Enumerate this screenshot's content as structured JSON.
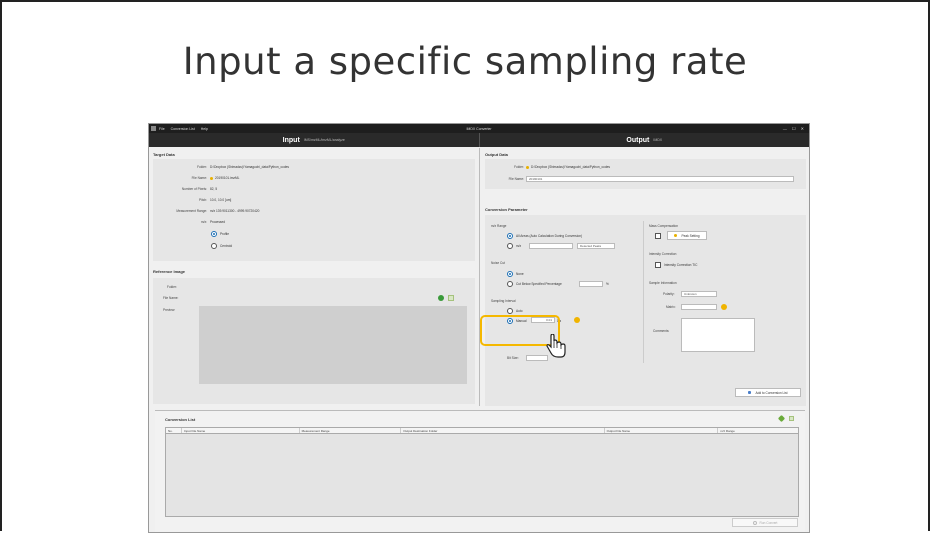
{
  "slide": {
    "title": "Input a specific sampling rate"
  },
  "window": {
    "title": "IMDX Converter",
    "menu": [
      "File",
      "Conversion List",
      "Help"
    ],
    "controls": "— ☐ ✕"
  },
  "input_pane": {
    "header": "Input",
    "header_sub": "IMS/mzML/imzML/analyze",
    "target_data": {
      "section_title": "Target Data",
      "folder_label": "Folder:",
      "folder_value": "D:\\Dropbox (Shimadzu)\\Yamaguchi_data\\Python_codes",
      "file_name_label": "File Name:",
      "file_name_value": "20190101.imzML",
      "num_pixels_label": "Number of Pixels:",
      "num_pixels_value": "82, 5",
      "pitch_label": "Pitch:",
      "pitch_value": "10.0, 10.0 [um]",
      "meas_range_label": "Measurement Range:",
      "meas_range_value": "m/z 139.9011300 - 4999.90720420",
      "mz_label": "m/z:",
      "mz_value": "Processed",
      "profile_label": "Profile",
      "centroid_label": "Centroid"
    },
    "reference_image": {
      "section_title": "Reference Image",
      "folder_label": "Folder:",
      "file_name_label": "File Name:",
      "preview_label": "Preview:"
    }
  },
  "output_pane": {
    "header": "Output",
    "header_sub": "IMDX",
    "output_data": {
      "section_title": "Output Data",
      "folder_label": "Folder:",
      "folder_value": "D:\\Dropbox (Shimadzu)\\Yamaguchi_data\\Python_codes",
      "file_name_label": "File Name:",
      "file_name_value": "20190101"
    },
    "conversion_parameter": {
      "section_title": "Conversion Parameter",
      "mz_range": {
        "title": "m/z Range",
        "option_all": "All Areas (Auto Calculation During Conversion)",
        "option_mz": "m/z",
        "detected_peaks": "Detected Peaks"
      },
      "noise_cut": {
        "title": "Noise Cut",
        "option_none": "None",
        "option_cut": "Cut Below Specified Percentage",
        "percent": "%"
      },
      "sampling_interval": {
        "title": "Sampling Interval",
        "option_auto": "Auto",
        "option_manual": "Manual",
        "manual_value": "0.01",
        "unit": "Da"
      },
      "bit_size_label": "Bit Size:",
      "mass_compensation": {
        "title": "Mass Compensation",
        "peak_setting": "Peak Setting"
      },
      "intensity_correction": {
        "title": "Intensity Correction",
        "tic_label": "Intensity Correction TIC"
      },
      "sample_info": {
        "title": "Sample Information",
        "polarity_label": "Polarity:",
        "polarity_value": "Unknown",
        "matrix_label": "Matrix:",
        "comments_label": "Comments:"
      },
      "add_button": "Add to Conversion List"
    }
  },
  "conversion_list": {
    "title": "Conversion List",
    "columns": [
      "No.",
      "Input File Name",
      "Measurement Range",
      "Output Destination Folder",
      "Output File Name",
      "m/z Range"
    ],
    "run_button": "Run Convert"
  }
}
